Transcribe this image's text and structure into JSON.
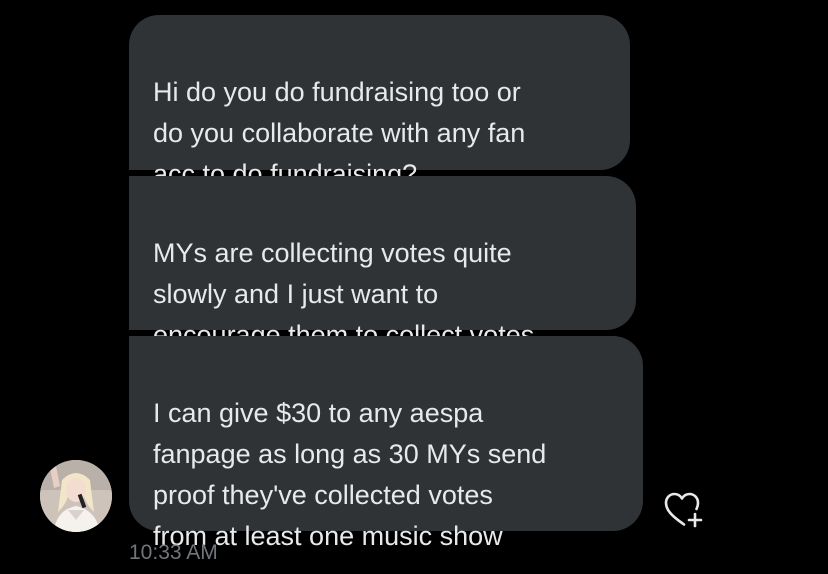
{
  "messages": [
    {
      "text": "Hi do you do fundraising too or\ndo you collaborate with any fan\nacc to do fundraising?"
    },
    {
      "text": "MYs are collecting votes quite\nslowly and I just want to\nencourage them to collect votes"
    },
    {
      "text": "I can give $30 to any aespa\nfanpage as long as 30 MYs send\nproof they've collected votes\nfrom at least one music show"
    }
  ],
  "timestamp": "10:33 AM",
  "colors": {
    "background": "#000000",
    "bubble": "#2f3336",
    "text": "#e7e9ea",
    "muted": "#71767b"
  },
  "icons": {
    "avatar": "profile-photo",
    "reaction": "heart-plus-icon"
  }
}
